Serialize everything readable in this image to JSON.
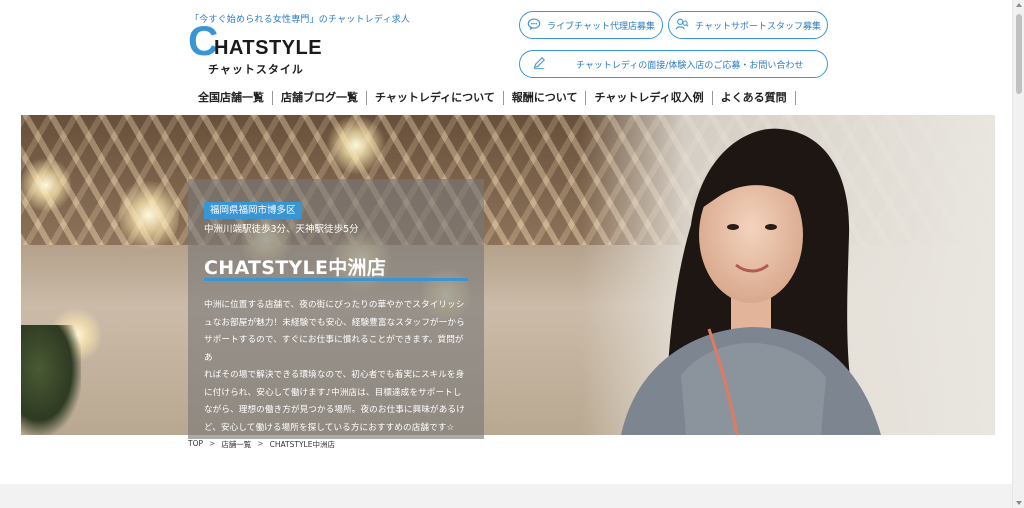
{
  "header": {
    "tagline": "「今すぐ始められる女性専門」のチャットレディ求人",
    "logo": {
      "initial": "C",
      "rest": "HATSTYLE",
      "kana": "チャットスタイル"
    },
    "buttons": {
      "agency": "ライブチャット代理店募集",
      "support_staff": "チャットサポートスタッフ募集",
      "contact": "チャットレディの面接/体験入店のご応募・お問い合わせ"
    }
  },
  "nav": {
    "items": [
      "全国店舗一覧",
      "店舗ブログ一覧",
      "チャットレディについて",
      "報酬について",
      "チャットレディ収入例",
      "よくある質問"
    ]
  },
  "hero": {
    "area": "福岡県福岡市博多区",
    "access": "中洲川端駅徒歩3分、天神駅徒歩5分",
    "shop_name": "CHATSTYLE中洲店",
    "description_lines": [
      "中洲に位置する店舗で、夜の街にぴったりの華やかでスタイリッシ",
      "ュなお部屋が魅力！未経験でも安心、経験豊富なスタッフが一から",
      "サポートするので、すぐにお仕事に慣れることができます。質問があ",
      "ればその場で解決できる環境なので、初心者でも着実にスキルを身",
      "に付けられ、安心して働けます♪中洲店は、目標達成をサポートし",
      "ながら、理想の働き方が見つかる場所。夜のお仕事に興味があるけ",
      "ど、安心して働ける場所を探している方におすすめの店舗です☆"
    ]
  },
  "breadcrumb": {
    "top": "TOP",
    "list": "店舗一覧",
    "current": "CHATSTYLE中洲店",
    "separator": ">"
  },
  "colors": {
    "accent": "#3a95d4",
    "overlay": "rgba(120,120,120,0.62)"
  },
  "icons": {
    "agency": "chat-bubble-icon",
    "support_staff": "support-staff-icon",
    "contact": "pencil-icon"
  }
}
